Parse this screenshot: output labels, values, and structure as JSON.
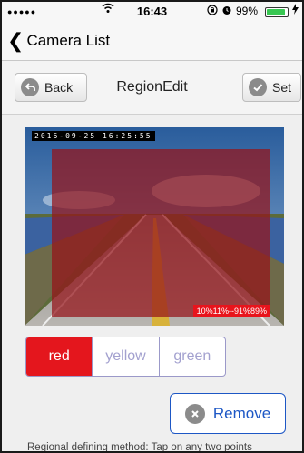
{
  "status_bar": {
    "signal": "●●●●●",
    "time": "16:43",
    "battery": "99%",
    "icons": [
      "wifi-icon",
      "rotation-lock-icon",
      "alarm-icon",
      "battery-icon",
      "charging-icon"
    ]
  },
  "nav": {
    "back_label": "Camera List"
  },
  "toolbar": {
    "back_label": "Back",
    "title": "RegionEdit",
    "set_label": "Set"
  },
  "camera": {
    "timestamp": "2016-09-25 16:25:55",
    "region_label": "10%11%--91%89%"
  },
  "colors": {
    "tabs": [
      "red",
      "yellow",
      "green"
    ],
    "selected": "red",
    "active_color": "#e4161d",
    "inactive_text": "#a3a1cf"
  },
  "remove_label": "Remove",
  "hint": "Regional defining method: Tap on any two points"
}
